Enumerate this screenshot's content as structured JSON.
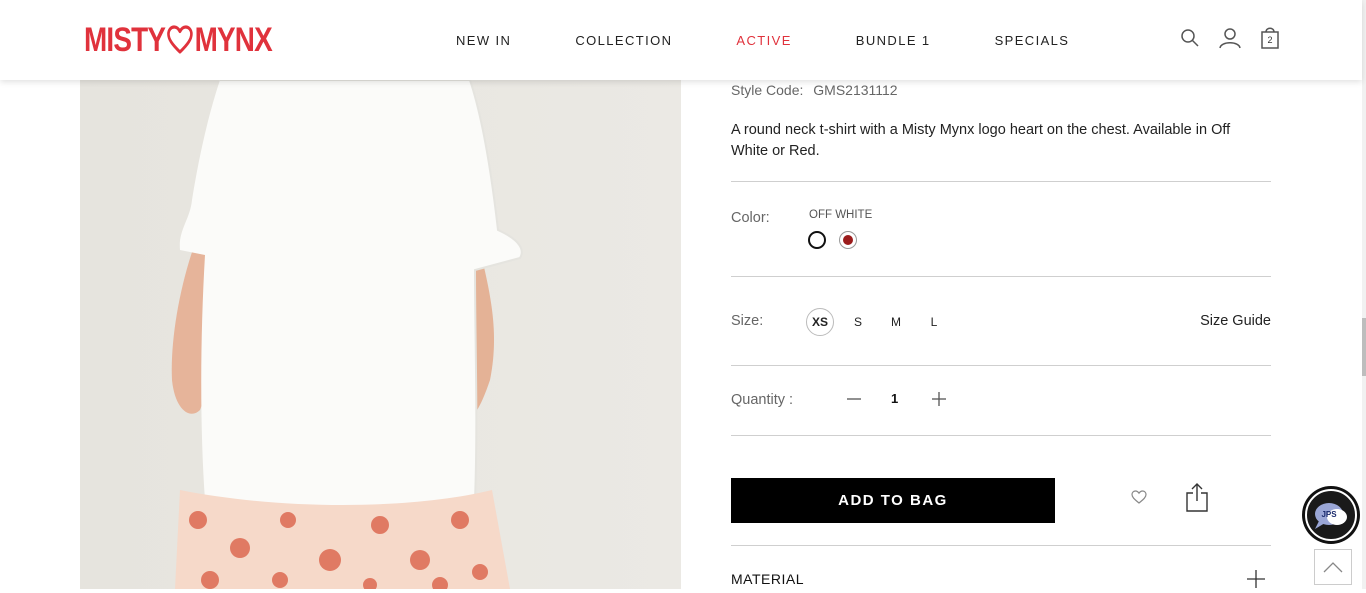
{
  "header": {
    "logo_left": "MISTY",
    "logo_right": "MYNX",
    "nav": [
      {
        "label": "NEW IN"
      },
      {
        "label": "COLLECTION"
      },
      {
        "label": "ACTIVE"
      },
      {
        "label": "BUNDLE 1"
      },
      {
        "label": "SPECIALS"
      }
    ],
    "active_nav": "ACTIVE",
    "bag_count": "2",
    "accent_color": "#e0323c"
  },
  "product": {
    "style_code_label": "Style Code:",
    "style_code": "GMS2131112",
    "description": "A round neck t-shirt with a Misty Mynx logo heart on the chest. Available in Off White or Red.",
    "color_label": "Color:",
    "color_selected": "OFF WHITE",
    "colors": [
      {
        "name": "off white",
        "hex": "#ffffff"
      },
      {
        "name": "red",
        "hex": "#9b1c1c"
      }
    ],
    "size_label": "Size:",
    "sizes": [
      "XS",
      "S",
      "M",
      "L"
    ],
    "size_selected": "XS",
    "size_guide": "Size Guide",
    "quantity_label": "Quantity :",
    "quantity": "1",
    "add_to_bag": "ADD TO BAG",
    "material_label": "MATERIAL"
  },
  "icons": [
    "search-icon",
    "user-icon",
    "bag-icon",
    "heart-icon",
    "share-icon",
    "plus-icon",
    "minus-icon",
    "chat-icon",
    "arrow-up-icon"
  ],
  "chat_badge": "JPS"
}
